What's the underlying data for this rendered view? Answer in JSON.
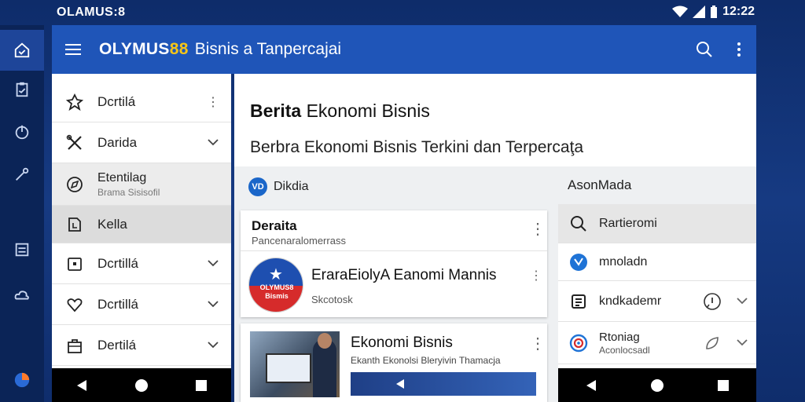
{
  "status": {
    "left_text": "OLAMUS:8",
    "time": "12:22"
  },
  "appbar": {
    "brand_text": "OLYMUS",
    "brand_num": "88",
    "subtitle": "Bisnis a Tanpercajai"
  },
  "nav": {
    "items": [
      {
        "label": "Dcrtilá",
        "icon": "badge-icon",
        "trail": "⋮"
      },
      {
        "label": "Darida",
        "icon": "cross-tools-icon",
        "trail": "chevron"
      },
      {
        "label": "Etentilag",
        "sub": "Brama Sisisofil",
        "icon": "compass-icon"
      },
      {
        "label": "Kella",
        "icon": "document-icon"
      },
      {
        "label": "Dcrtillá",
        "icon": "folder-icon",
        "trail": "chevron"
      },
      {
        "label": "Dcrtillá",
        "icon": "heart-icon",
        "trail": "chevron"
      },
      {
        "label": "Dertilá",
        "icon": "bag-icon",
        "trail": "chevron"
      }
    ]
  },
  "main": {
    "title_bold": "Berita",
    "title_rest": " Ekonomi Bisnis",
    "description": "Berbra Ekonomi Bisnis Terkini dan Terpercaţa",
    "source_label": "Dikdia",
    "source_badge": "VD",
    "right_label": "AsonMada"
  },
  "card1": {
    "title": "Deraita",
    "subtitle": "Pancenaralomerrass",
    "headline": "EraraEiolyA Eanomi Mannis",
    "meta": "Skcotosk",
    "logo_text": "OLYMUS8 Bismis"
  },
  "card2": {
    "title": "Ekonomi Bisnis",
    "subtitle": "Ekanth Ekonolsi Bleryivin Thamacja"
  },
  "right_panel": {
    "items": [
      {
        "label": "Rartieromi",
        "icon": "search-icon"
      },
      {
        "label": "mnoladn",
        "icon": "twitter-bird-icon"
      },
      {
        "label": "kndkademr",
        "icon": "id-card-icon"
      },
      {
        "label": "Rtoniag",
        "sub": "Aconlocsadl",
        "icon": "target-icon"
      }
    ]
  },
  "colors": {
    "appbar": "#1f55b8",
    "background": "#163a82",
    "brand_accent": "#f5c518"
  }
}
